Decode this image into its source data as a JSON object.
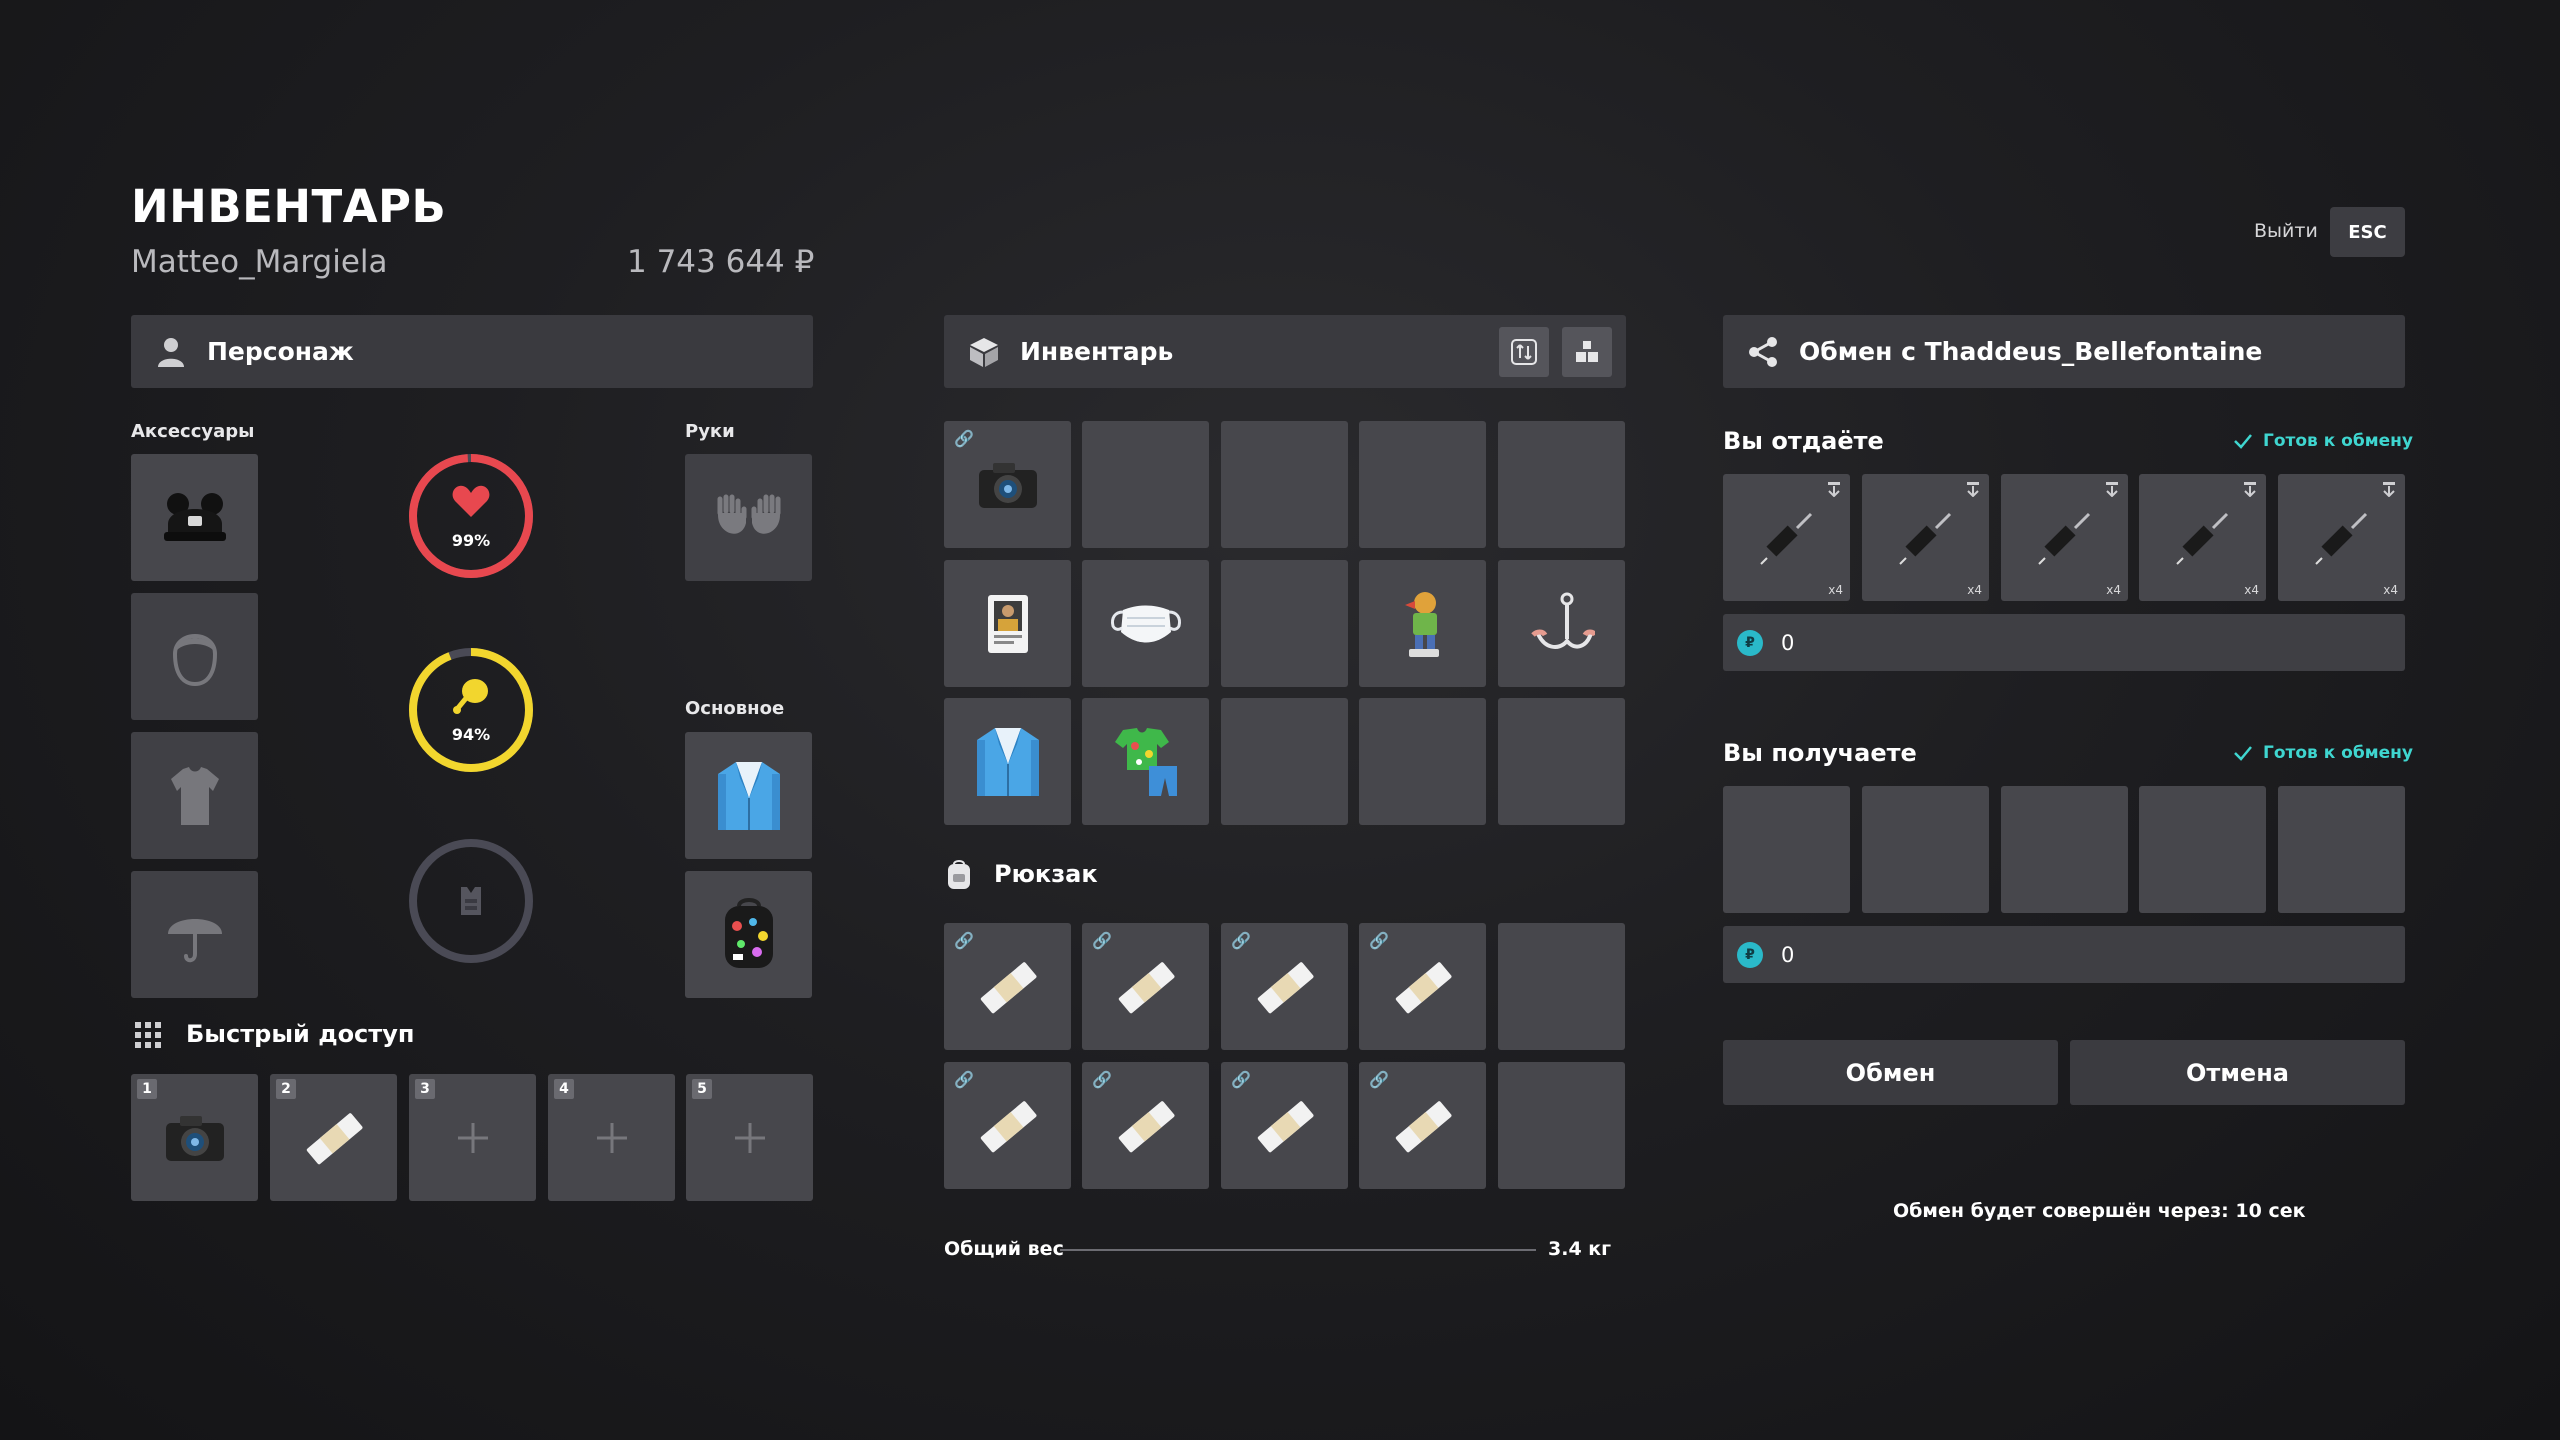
{
  "header": {
    "title": "ИНВЕНТАРЬ",
    "player_name": "Matteo_Margiela",
    "money": "1 743 644 ₽",
    "exit_label": "Выйти",
    "exit_key": "ESC"
  },
  "character": {
    "header_title": "Персонаж",
    "accessories_label": "Аксессуары",
    "hands_label": "Руки",
    "main_label": "Основное",
    "health_pct": "99%",
    "hunger_pct": "94%",
    "health_value": 0.99,
    "hunger_value": 0.94,
    "colors": {
      "health": "#e8484f",
      "hunger": "#f2d62e",
      "armor": "#4a4a55"
    }
  },
  "quick_access": {
    "title": "Быстрый доступ",
    "slots": [
      "1",
      "2",
      "3",
      "4",
      "5"
    ]
  },
  "inventory": {
    "header_title": "Инвентарь",
    "backpack_title": "Рюкзак",
    "weight_label": "Общий вес",
    "weight_value": "3.4 кг"
  },
  "trade": {
    "header_title": "Обмен с Thaddeus_Bellefontaine",
    "give_label": "Вы отдаёте",
    "get_label": "Вы получаете",
    "ready_give": "Готов к обмену",
    "ready_get": "Готов к обмену",
    "give_money": "0",
    "get_money": "0",
    "give_item_qty": [
      "x4",
      "x4",
      "x4",
      "x4",
      "x4"
    ],
    "coin_symbol": "₽",
    "exchange_button": "Обмен",
    "cancel_button": "Отмена",
    "timer_text": "Обмен будет совершён через: 10 сек"
  }
}
